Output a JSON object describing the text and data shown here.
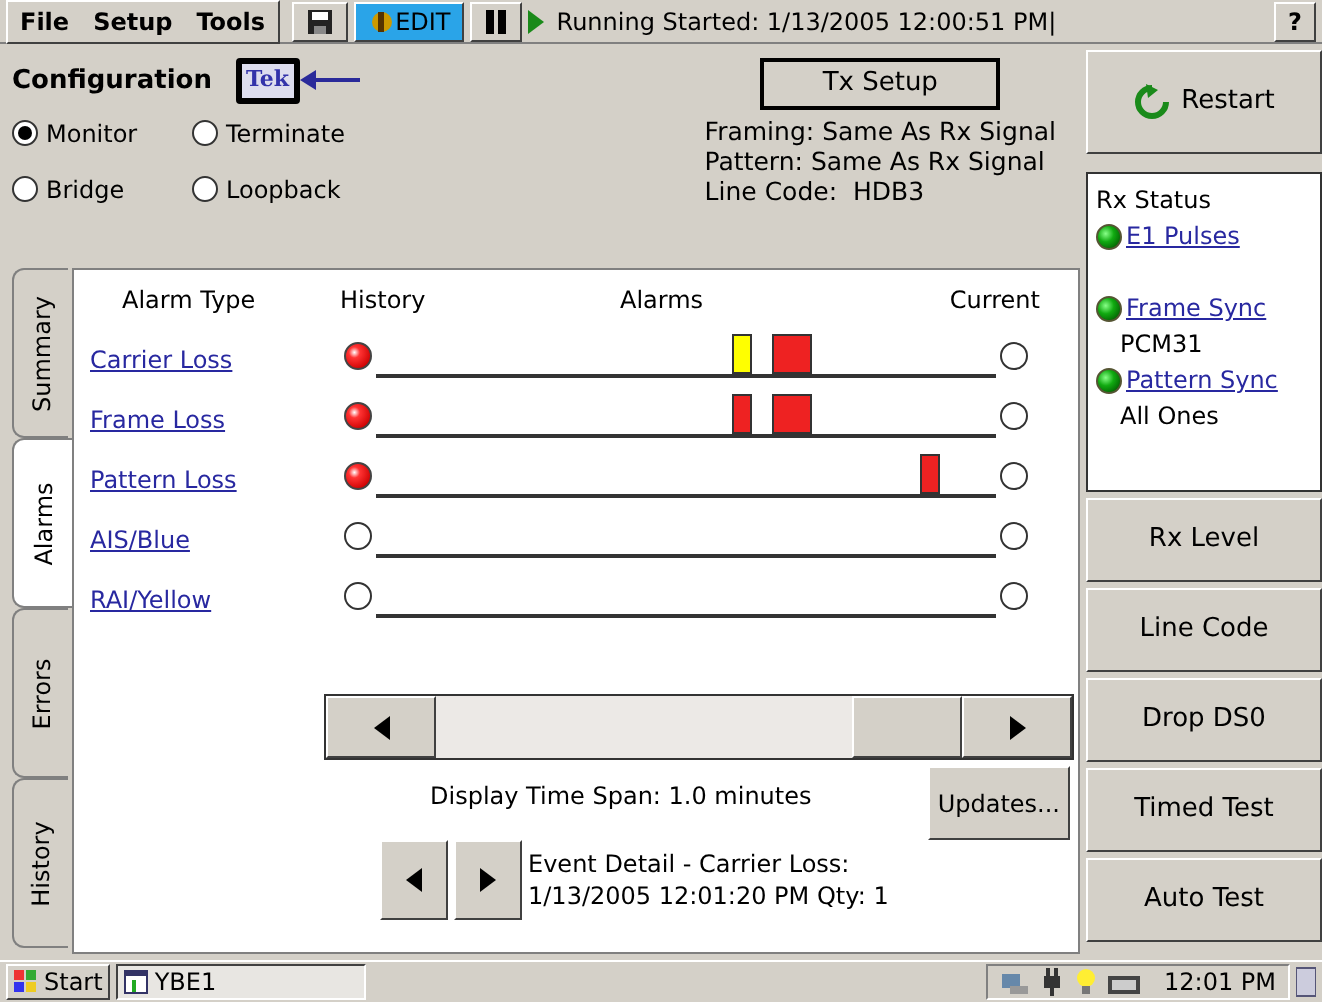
{
  "menu_bar": {
    "menus": [
      "File",
      "Setup",
      "Tools"
    ],
    "edit_label": "EDIT",
    "status": "Running Started: 1/13/2005 12:00:51 PM|",
    "help": "?"
  },
  "configuration": {
    "title": "Configuration",
    "logo": "Tek",
    "modes": [
      {
        "label": "Monitor",
        "selected": true
      },
      {
        "label": "Terminate",
        "selected": false
      },
      {
        "label": "Bridge",
        "selected": false
      },
      {
        "label": "Loopback",
        "selected": false
      }
    ],
    "tx_setup": "Tx Setup",
    "details": [
      "Framing: Same As Rx Signal",
      "Pattern: Same As Rx Signal",
      "Line Code:  HDB3"
    ]
  },
  "tabs": [
    {
      "label": "Summary",
      "selected": false
    },
    {
      "label": "Alarms",
      "selected": true
    },
    {
      "label": "Errors",
      "selected": false
    },
    {
      "label": "History",
      "selected": false
    }
  ],
  "alarm_table": {
    "columns": [
      "Alarm Type",
      "History",
      "Alarms",
      "Current"
    ],
    "rows": [
      {
        "name": "Carrier Loss",
        "history": true,
        "current": false,
        "events": [
          {
            "color": "#ffff00",
            "kind": "narrow"
          },
          {
            "color": "#ee2222",
            "kind": "wide"
          }
        ]
      },
      {
        "name": "Frame Loss",
        "history": true,
        "current": false,
        "events": [
          {
            "color": "#ee2222",
            "kind": "narrow"
          },
          {
            "color": "#ee2222",
            "kind": "wide"
          }
        ]
      },
      {
        "name": "Pattern Loss",
        "history": true,
        "current": false,
        "events": [
          {
            "color": "#ee2222",
            "kind": "narrow"
          }
        ]
      },
      {
        "name": "AIS/Blue",
        "history": false,
        "current": false,
        "events": []
      },
      {
        "name": "RAI/Yellow",
        "history": false,
        "current": false,
        "events": []
      }
    ]
  },
  "time_span": "Display Time Span: 1.0 minutes",
  "updates_button": "Updates...",
  "event_detail": [
    "Event Detail - Carrier Loss:",
    "1/13/2005 12:01:20 PM Qty: 1"
  ],
  "side_panel": {
    "restart": "Restart",
    "rx_status": {
      "title": "Rx Status",
      "items": [
        {
          "label": "E1 Pulses",
          "ok": true
        },
        {
          "label": "Frame Sync",
          "ok": true,
          "detail": "PCM31"
        },
        {
          "label": "Pattern Sync",
          "ok": true,
          "detail": "All Ones"
        }
      ]
    },
    "buttons": [
      "Rx Level",
      "Line Code",
      "Drop DS0",
      "Timed Test",
      "Auto Test"
    ]
  },
  "taskbar": {
    "start": "Start",
    "task": "YBE1",
    "clock": "12:01 PM"
  }
}
